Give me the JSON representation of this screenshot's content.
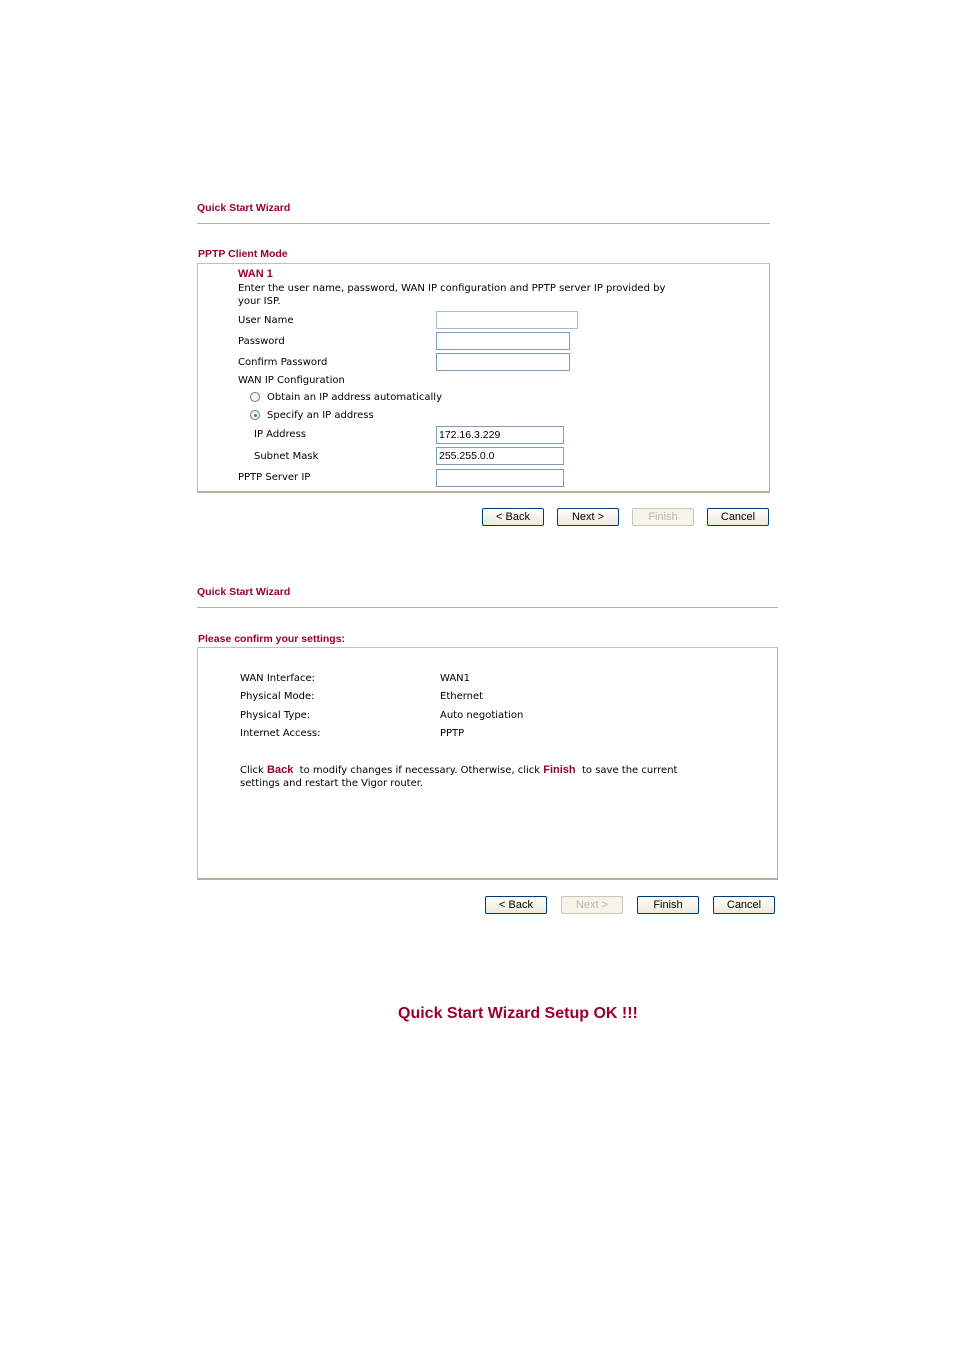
{
  "panel1": {
    "title": "Quick Start Wizard",
    "section_title": "PPTP Client Mode",
    "wan_heading": "WAN 1",
    "instructions_line1": "Enter the user name, password, WAN IP configuration and PPTP server IP provided by",
    "instructions_line2": "your ISP.",
    "fields": {
      "user_name": {
        "label": "User Name",
        "value": ""
      },
      "password": {
        "label": "Password",
        "value": ""
      },
      "confirm_password": {
        "label": "Confirm Password",
        "value": ""
      },
      "wan_ip_config_label": "WAN IP Configuration",
      "radio_obtain": {
        "label": "Obtain an IP address automatically",
        "checked": false
      },
      "radio_specify": {
        "label": "Specify an IP address",
        "checked": true
      },
      "ip_address": {
        "label": "IP Address",
        "value": "172.16.3.229"
      },
      "subnet_mask": {
        "label": "Subnet Mask",
        "value": "255.255.0.0"
      },
      "pptp_server_ip": {
        "label": "PPTP Server IP",
        "value": ""
      }
    },
    "buttons": {
      "back": "< Back",
      "next": "Next >",
      "finish": "Finish",
      "cancel": "Cancel"
    }
  },
  "panel2": {
    "title": "Quick Start Wizard",
    "section_title": "Please confirm your settings:",
    "settings": [
      {
        "label": "WAN Interface:",
        "value": "WAN1"
      },
      {
        "label": "Physical Mode:",
        "value": "Ethernet"
      },
      {
        "label": "Physical Type:",
        "value": "Auto negotiation"
      },
      {
        "label": "Internet Access:",
        "value": "PPTP"
      }
    ],
    "note": {
      "prefix": "Click ",
      "back_word": "Back",
      "middle": "  to modify changes if necessary. Otherwise, click ",
      "finish_word": "Finish",
      "suffix": "  to save the current",
      "line2": "settings and restart the Vigor router."
    },
    "buttons": {
      "back": "< Back",
      "next": "Next >",
      "finish": "Finish",
      "cancel": "Cancel"
    }
  },
  "result_message": "Quick Start Wizard Setup OK !!!"
}
